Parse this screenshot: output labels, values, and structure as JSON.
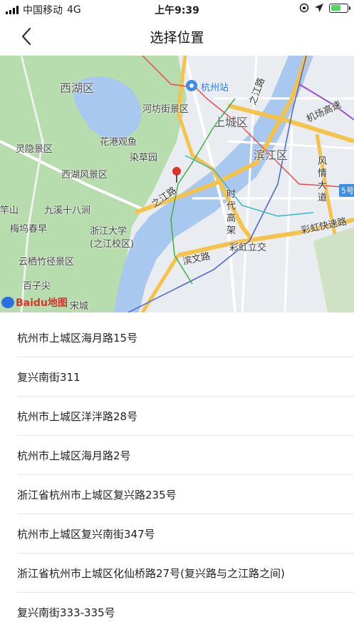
{
  "status_bar": {
    "carrier": "中国移动",
    "network": "4G",
    "time": "上午9:39"
  },
  "nav": {
    "title": "选择位置"
  },
  "map": {
    "labels": {
      "xihu_district": "西湖区",
      "hangzhou_station": "杭州站",
      "hefang_street": "河坊街景区",
      "shangcheng_district": "上城区",
      "zhijiang_road_ne": "之江路",
      "airport_expressway": "机场高速",
      "lingyin": "灵隐景区",
      "huagang": "花港观鱼",
      "ranchaoyuan": "染草园",
      "binjiang_district": "滨江区",
      "xihu_scenic": "西湖风景区",
      "fengqing_avenue": "风情大道",
      "highway_5": "5号",
      "zhijiang_road": "之江路",
      "shidai_elevated": "时代高架",
      "ganshan": "竿山",
      "jiuxi": "九溪十八涧",
      "meiwu": "梅坞春早",
      "zju": "浙江大学\n(之江校区)",
      "caihong_expressway": "彩虹快速路",
      "caihong_interchange": "彩虹立交",
      "binwen_road": "滨文路",
      "yunqi": "云栖竹径景区",
      "baizijian": "百子尖",
      "songcheng": "宋城",
      "baidu_logo": "Baidu地图"
    },
    "colors": {
      "water": "#a9c8ef",
      "green": "#b7dcae",
      "marker": "#e0312a",
      "expressway": "#f5c24a"
    }
  },
  "locations": [
    {
      "address": "杭州市上城区海月路15号"
    },
    {
      "address": "复兴南街311"
    },
    {
      "address": "杭州市上城区洋泮路28号"
    },
    {
      "address": "杭州市上城区海月路2号"
    },
    {
      "address": "浙江省杭州市上城区复兴路235号"
    },
    {
      "address": "杭州市上城区复兴南街347号"
    },
    {
      "address": "浙江省杭州市上城区化仙桥路27号(复兴路与之江路之间)"
    },
    {
      "address": "复兴南街333-335号"
    }
  ]
}
